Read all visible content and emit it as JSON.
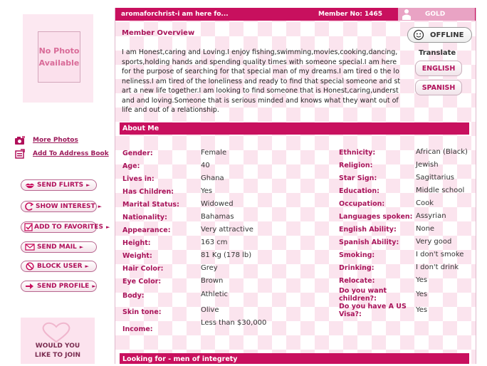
{
  "sidebar": {
    "photo_text_1": "No Photo",
    "photo_text_2": "Available",
    "links": [
      {
        "label": "More Photos",
        "icon": "camera-icon"
      },
      {
        "label": "Add To Address Book",
        "icon": "address-book-icon"
      }
    ],
    "actions": [
      {
        "label": "SEND FLIRTS",
        "icon": "lips-icon"
      },
      {
        "label": "SHOW INTEREST",
        "icon": "interest-icon"
      },
      {
        "label": "ADD TO FAVORITES",
        "icon": "checkbox-icon"
      },
      {
        "label": "SEND MAIL",
        "icon": "envelope-icon"
      },
      {
        "label": "BLOCK USER",
        "icon": "block-icon"
      },
      {
        "label": "SEND PROFILE",
        "icon": "send-arrow-icon"
      }
    ],
    "join_line_1": "WOULD YOU",
    "join_line_2": "LIKE TO JOIN"
  },
  "header": {
    "username": "aromaforchrist-i am here fo...",
    "member_no": "Member No: 1465",
    "level": "GOLD"
  },
  "overview": {
    "title": "Member Overview",
    "text": "I am Honest,caring and Loving.I enjoy fishing,swimming,movies,cooking,dancing,sports,holding hands and spending quality times with someone special.I am here for the purpose of searching for that special man of my dreams.I am tired o the loneliness.I am tired of the loneliness and ready to find that special someone and start a new life together.I am looking to find someone that is Honest,caring,understand and loving.Someone that is serious minded and knows what they want out of life and out of a relationship."
  },
  "status": {
    "offline_label": "OFFLINE"
  },
  "translate": {
    "label": "Translate",
    "english": "ENGLISH",
    "spanish": "SPANISH"
  },
  "about_me": {
    "title": "About Me",
    "left": [
      {
        "label": "Gender:",
        "value": "Female"
      },
      {
        "label": "Age:",
        "value": "40"
      },
      {
        "label": "Lives in:",
        "value": "Ghana"
      },
      {
        "label": "Has Children:",
        "value": "Yes"
      },
      {
        "label": "Marital Status:",
        "value": "Widowed"
      },
      {
        "label": "Nationality:",
        "value": "Bahamas"
      },
      {
        "label": "Appearance:",
        "value": "Very attractive"
      },
      {
        "label": "Height:",
        "value": "163 cm"
      },
      {
        "label": "Weight:",
        "value": "81 Kg (178 lb)"
      },
      {
        "label": "Hair Color:",
        "value": "Grey"
      },
      {
        "label": "Eye Color:",
        "value": "Brown"
      },
      {
        "label": "Body:",
        "value": "Athletic"
      },
      {
        "label": "Skin tone:",
        "value": "Olive"
      },
      {
        "label": "Income:",
        "value": "Less than $30,000"
      }
    ],
    "right": [
      {
        "label": "Ethnicity:",
        "value": "African (Black)"
      },
      {
        "label": "Religion:",
        "value": "Jewish"
      },
      {
        "label": "Star Sign:",
        "value": "Sagittarius"
      },
      {
        "label": "Education:",
        "value": "Middle school"
      },
      {
        "label": "Occupation:",
        "value": "Cook"
      },
      {
        "label": "Languages spoken:",
        "value": "Assyrian"
      },
      {
        "label": "English Ability:",
        "value": "None"
      },
      {
        "label": "Spanish Ability:",
        "value": "Very good"
      },
      {
        "label": "Smoking:",
        "value": "I don't smoke"
      },
      {
        "label": "Drinking:",
        "value": "I don't drink"
      },
      {
        "label": "Relocate:",
        "value": "Yes"
      },
      {
        "label": "Do you want children?:",
        "value": "Yes"
      },
      {
        "label": "Do you have A US Visa?:",
        "value": "Yes"
      }
    ]
  },
  "looking_for": {
    "title": "Looking for - men of integrety"
  },
  "colors": {
    "brand": "#c8105e",
    "label": "#a8145a",
    "pattern": "#fbe4ee"
  }
}
